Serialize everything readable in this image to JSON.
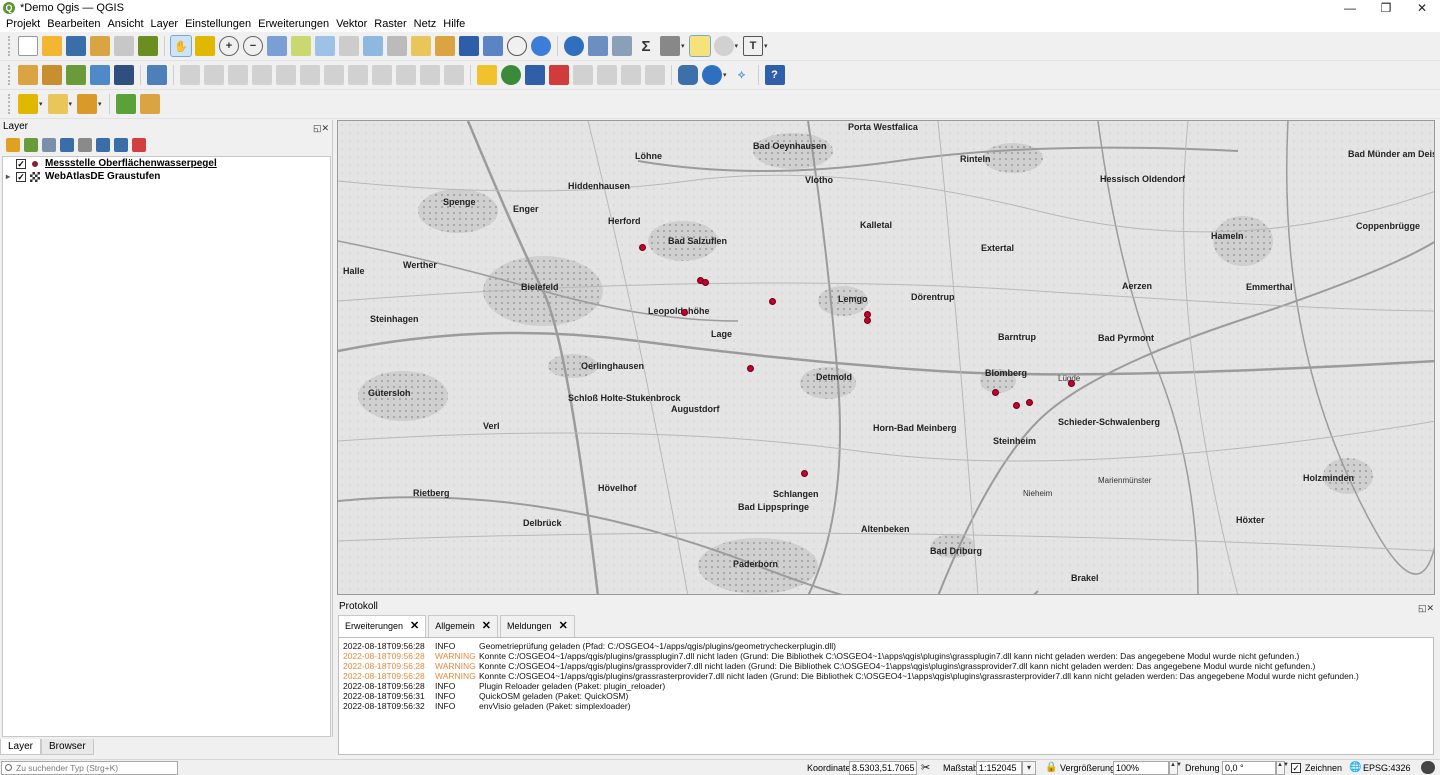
{
  "window": {
    "title": "*Demo Qgis — QGIS",
    "app_icon": "Q",
    "minimize": "—",
    "maximize": "❐",
    "close": "✕"
  },
  "menu": [
    "Projekt",
    "Bearbeiten",
    "Ansicht",
    "Layer",
    "Einstellungen",
    "Erweiterungen",
    "Vektor",
    "Raster",
    "Netz",
    "Hilfe"
  ],
  "layers_panel": {
    "title": "Layer",
    "controls": "◱✕",
    "layers": [
      {
        "name": "Messstelle Oberflächenwasserpegel",
        "checked": "✓",
        "expander": ""
      },
      {
        "name": "WebAtlasDE Graustufen",
        "checked": "✓",
        "expander": "▸"
      }
    ],
    "tabs": [
      "Layer",
      "Browser"
    ]
  },
  "map": {
    "labels": [
      "Porta Westfalica",
      "Bad Oeynhausen",
      "Rinteln",
      "Hessisch Oldendorf",
      "Bad Münder am Deister",
      "Herford",
      "Bad Salzuflen",
      "Kalletal",
      "Extertal",
      "Hameln",
      "Coppenbrügge",
      "Bielefeld",
      "Leopoldshöhe",
      "Lage",
      "Lemgo",
      "Dörentrup",
      "Aerzen",
      "Emmerthal",
      "Bad Pyrmont",
      "Oerlinghausen",
      "Detmold",
      "Blomberg",
      "Barntrup",
      "Lügde",
      "Gütersloh",
      "Schloß Holte-Stukenbrock",
      "Augustdorf",
      "Horn-Bad Meinberg",
      "Schieder-Schwalenberg",
      "Steinheim",
      "Schlangen",
      "Hövelhof",
      "Nieheim",
      "Marienmünster",
      "Holzminden",
      "Bad Lippspringe",
      "Altenbeken",
      "Bad Driburg",
      "Paderborn",
      "Delbrück",
      "Höxter",
      "Verl",
      "Rietberg",
      "Vlotho",
      "Spenge",
      "Enger",
      "Werther",
      "Halle",
      "Steinhagen",
      "Löhne",
      "Hiddenhausen",
      "Brakel"
    ]
  },
  "log_panel": {
    "title": "Protokoll",
    "controls": "◱✕",
    "tabs": [
      {
        "label": "Erweiterungen",
        "close": "✕"
      },
      {
        "label": "Allgemein",
        "close": "✕"
      },
      {
        "label": "Meldungen",
        "close": "✕"
      }
    ],
    "lines": [
      {
        "time": "2022-08-18T09:56:28",
        "level": "INFO",
        "msg": "Geometrieprüfung geladen (Pfad: C:/OSGEO4~1/apps/qgis/plugins/geometrycheckerplugin.dll)"
      },
      {
        "time": "2022-08-18T09:56:28",
        "level": "WARNING",
        "msg": "Konnte C:/OSGEO4~1/apps/qgis/plugins/grassplugin7.dll nicht laden (Grund: Die Bibliothek C:\\OSGEO4~1\\apps\\qgis\\plugins\\grassplugin7.dll kann nicht geladen werden: Das angegebene Modul wurde nicht gefunden.)"
      },
      {
        "time": "2022-08-18T09:56:28",
        "level": "WARNING",
        "msg": "Konnte C:/OSGEO4~1/apps/qgis/plugins/grassprovider7.dll nicht laden (Grund: Die Bibliothek C:\\OSGEO4~1\\apps\\qgis\\plugins\\grassprovider7.dll kann nicht geladen werden: Das angegebene Modul wurde nicht gefunden.)"
      },
      {
        "time": "2022-08-18T09:56:28",
        "level": "WARNING",
        "msg": "Konnte C:/OSGEO4~1/apps/qgis/plugins/grassrasterprovider7.dll nicht laden (Grund: Die Bibliothek C:\\OSGEO4~1\\apps\\qgis\\plugins\\grassrasterprovider7.dll kann nicht geladen werden: Das angegebene Modul wurde nicht gefunden.)"
      },
      {
        "time": "2022-08-18T09:56:28",
        "level": "INFO",
        "msg": "Plugin Reloader geladen (Paket: plugin_reloader)"
      },
      {
        "time": "2022-08-18T09:56:31",
        "level": "INFO",
        "msg": "QuickOSM geladen (Paket: QuickOSM)"
      },
      {
        "time": "2022-08-18T09:56:32",
        "level": "INFO",
        "msg": "envVisio geladen (Paket: simplexloader)"
      }
    ]
  },
  "statusbar": {
    "search_placeholder": "Zu suchender Typ (Strg+K)",
    "coord_label": "Koordinate",
    "coord_value": "8.5303,51.7065",
    "scale_label": "Maßstab",
    "scale_value": "1:152045",
    "zoom_label": "Vergrößerung",
    "zoom_value": "100%",
    "rotation_label": "Drehung",
    "rotation_value": "0,0 °",
    "render_checked": "✓",
    "render_label": "Zeichnen",
    "crs": "EPSG:4326",
    "spin": "▲▼",
    "dropdown": "▾"
  },
  "colors": {
    "accent": "#589632",
    "warning": "#e68a3a",
    "pegel": "#c4002b"
  },
  "icons": [
    "new-project-icon",
    "open-project-icon",
    "save-project-icon",
    "save-as-icon",
    "print-layout-icon",
    "style-manager-icon",
    "pan-icon",
    "pan-to-selection-icon",
    "zoom-in-icon",
    "zoom-out-icon",
    "zoom-full-icon",
    "zoom-selection-icon",
    "zoom-layer-icon",
    "zoom-native-icon",
    "zoom-last-icon",
    "zoom-next-icon",
    "new-map-view-icon",
    "new-3d-view-icon",
    "spatial-bookmark-icon",
    "show-bookmarks-icon",
    "temporal-controller-icon",
    "refresh-icon",
    "identify-icon",
    "attribute-table-icon",
    "field-calculator-icon",
    "statistics-icon",
    "measure-icon",
    "map-tips-icon",
    "select-icon",
    "text-annotation-icon",
    "python-console-icon",
    "help-icon"
  ]
}
